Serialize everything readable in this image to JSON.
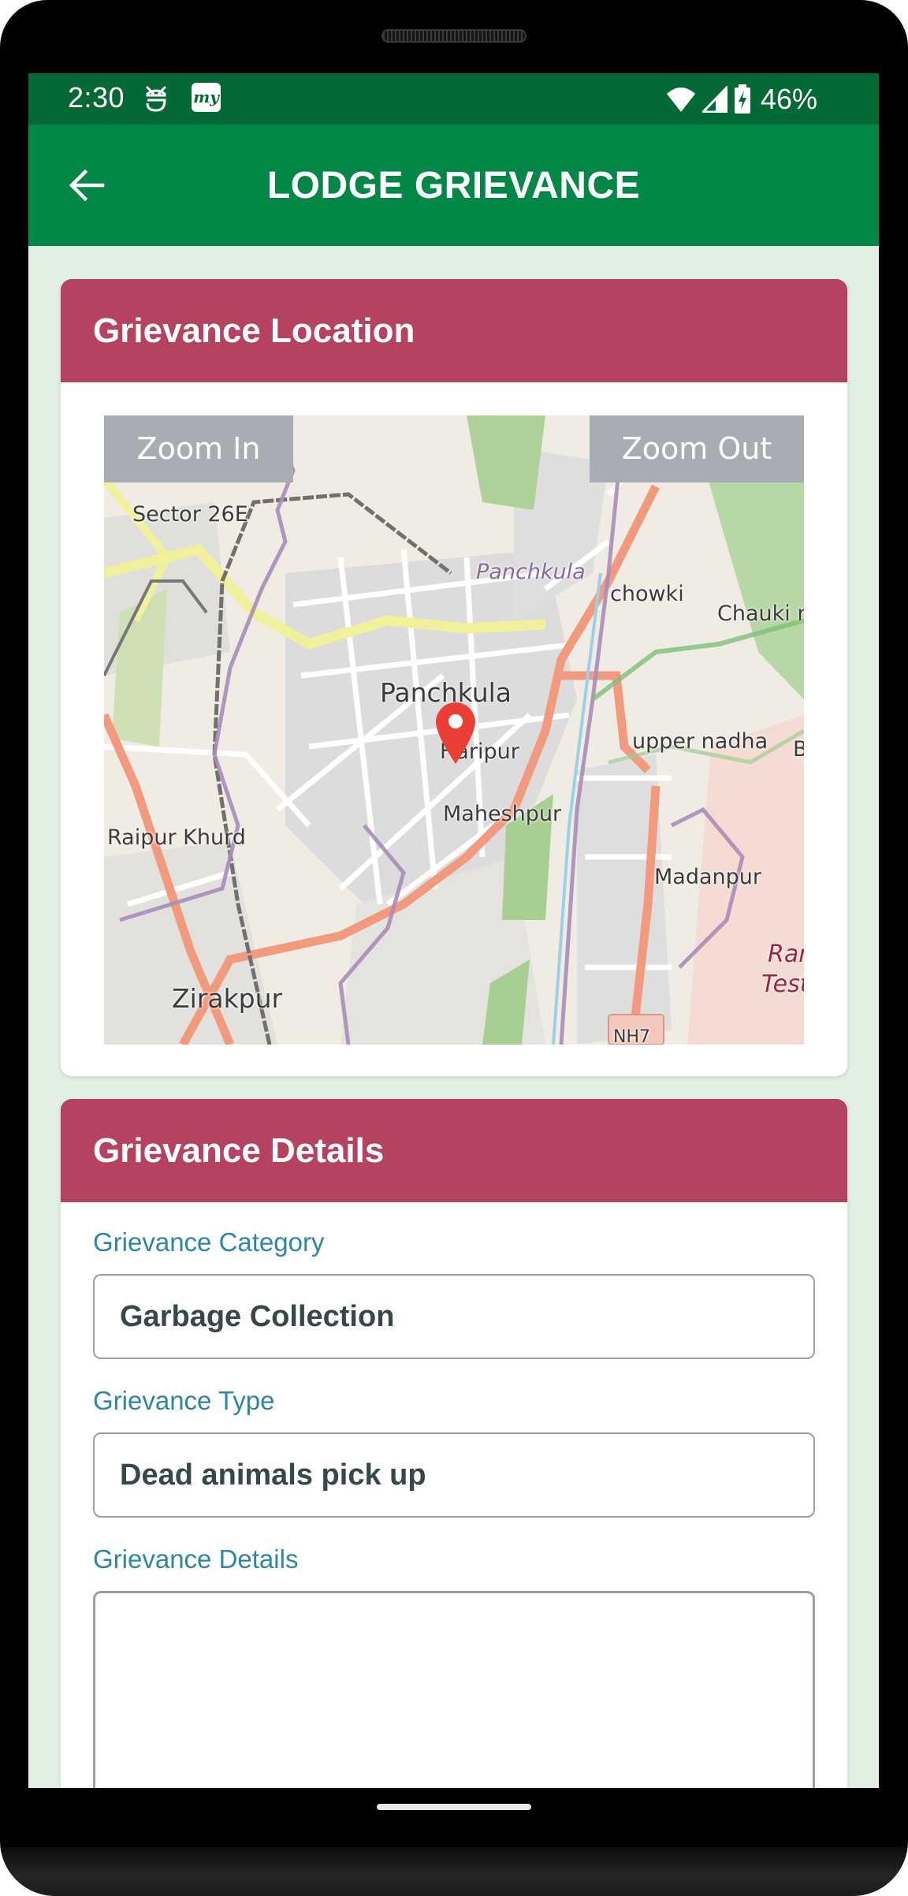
{
  "status_bar": {
    "time": "2:30",
    "notification_icons": [
      "robot-face-icon",
      "my-app-icon"
    ],
    "my_app_text": "my",
    "system_icons": [
      "wifi-icon",
      "cellular-signal-icon",
      "battery-charging-icon"
    ],
    "battery_percent": "46%"
  },
  "app_bar": {
    "back_icon": "arrow-left-icon",
    "title": "LODGE GRIEVANCE"
  },
  "location_card": {
    "title": "Grievance Location",
    "zoom_in_label": "Zoom In",
    "zoom_out_label": "Zoom Out",
    "map_labels": [
      "Sector 26E",
      "Panchkula",
      "chowki",
      "Chauki n",
      "Panchkula",
      "Haripur",
      "upper nadha",
      "B",
      "Maheshpur",
      "Raipur Khurd",
      "Madanpur",
      "Zirakpur",
      "Ran",
      "Test",
      "NH7"
    ],
    "pin_icon": "map-pin-icon"
  },
  "details_card": {
    "title": "Grievance Details",
    "fields": [
      {
        "label": "Grievance Category",
        "value": "Garbage Collection"
      },
      {
        "label": "Grievance Type",
        "value": "Dead animals pick up"
      },
      {
        "label": "Grievance Details",
        "value": ""
      }
    ]
  },
  "colors": {
    "status_bar": "#046935",
    "app_bar": "#028746",
    "background": "#e2f0e4",
    "card_header": "#b5425f",
    "field_label": "#2e87a0",
    "field_text": "#37474a",
    "map_pin": "#ea3f35"
  }
}
